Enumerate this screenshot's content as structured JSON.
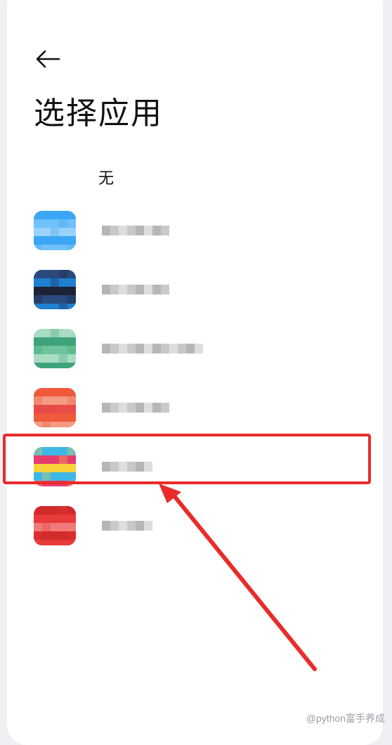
{
  "header": {
    "back_icon": "arrow-left-icon",
    "title": "选择应用"
  },
  "options": {
    "none_label": "无"
  },
  "apps": [
    {
      "icon": "app-blue-icon",
      "colors": [
        "#3aa6f5",
        "#6fc0fb",
        "#9ad2fc"
      ],
      "name": ""
    },
    {
      "icon": "app-dark-icon",
      "colors": [
        "#1c2336",
        "#2a4a7e",
        "#1f7fd0"
      ],
      "name": ""
    },
    {
      "icon": "app-green-icon",
      "colors": [
        "#3fa37a",
        "#6cc39c",
        "#a8dcc3"
      ],
      "name": ""
    },
    {
      "icon": "app-orange-icon",
      "colors": [
        "#ef5a3a",
        "#f59a85",
        "#e84a4a"
      ],
      "name": ""
    },
    {
      "icon": "app-colorful-icon",
      "colors": [
        "#f7d23a",
        "#3fb6e8",
        "#e63b6f"
      ],
      "name": ""
    },
    {
      "icon": "app-red-icon",
      "colors": [
        "#e83a3a",
        "#f07a7a",
        "#d12a2a"
      ],
      "name": ""
    }
  ],
  "annotation": {
    "highlight_color": "#ea2b2b",
    "highlighted_index": 4
  },
  "watermark": "@python富手养成"
}
